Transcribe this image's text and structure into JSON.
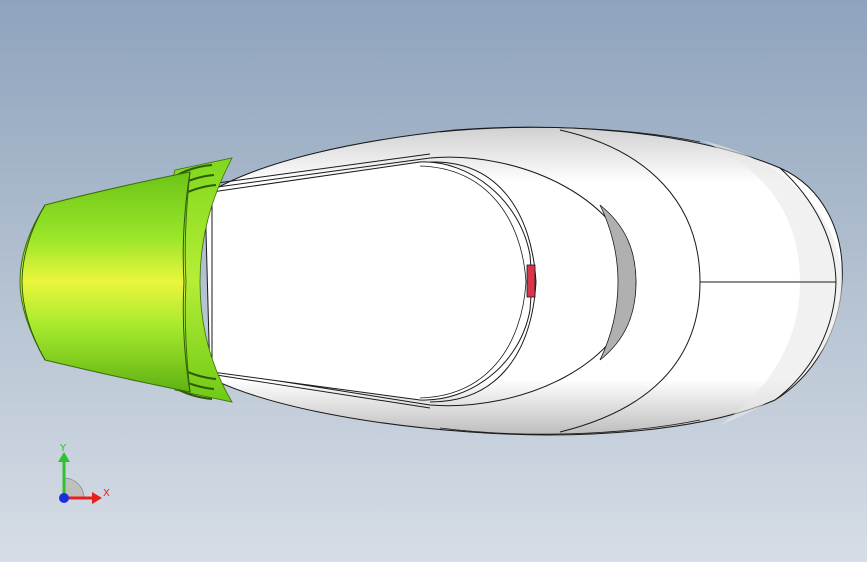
{
  "viewport": {
    "background_top": "#8ea3bd",
    "background_bottom": "#d6dde6"
  },
  "model": {
    "body_color": "#ffffff",
    "shadow_color": "#9c9c9c",
    "nozzle_color": "#7ad61e",
    "nozzle_highlight": "#e6f53a",
    "marker_color": "#d9344a",
    "edge_color": "#1a1a1a"
  },
  "triad": {
    "x_label": "X",
    "y_label": "Y",
    "x_color": "#e8201c",
    "y_color": "#2ec22e",
    "z_color": "#1a2ee0"
  }
}
